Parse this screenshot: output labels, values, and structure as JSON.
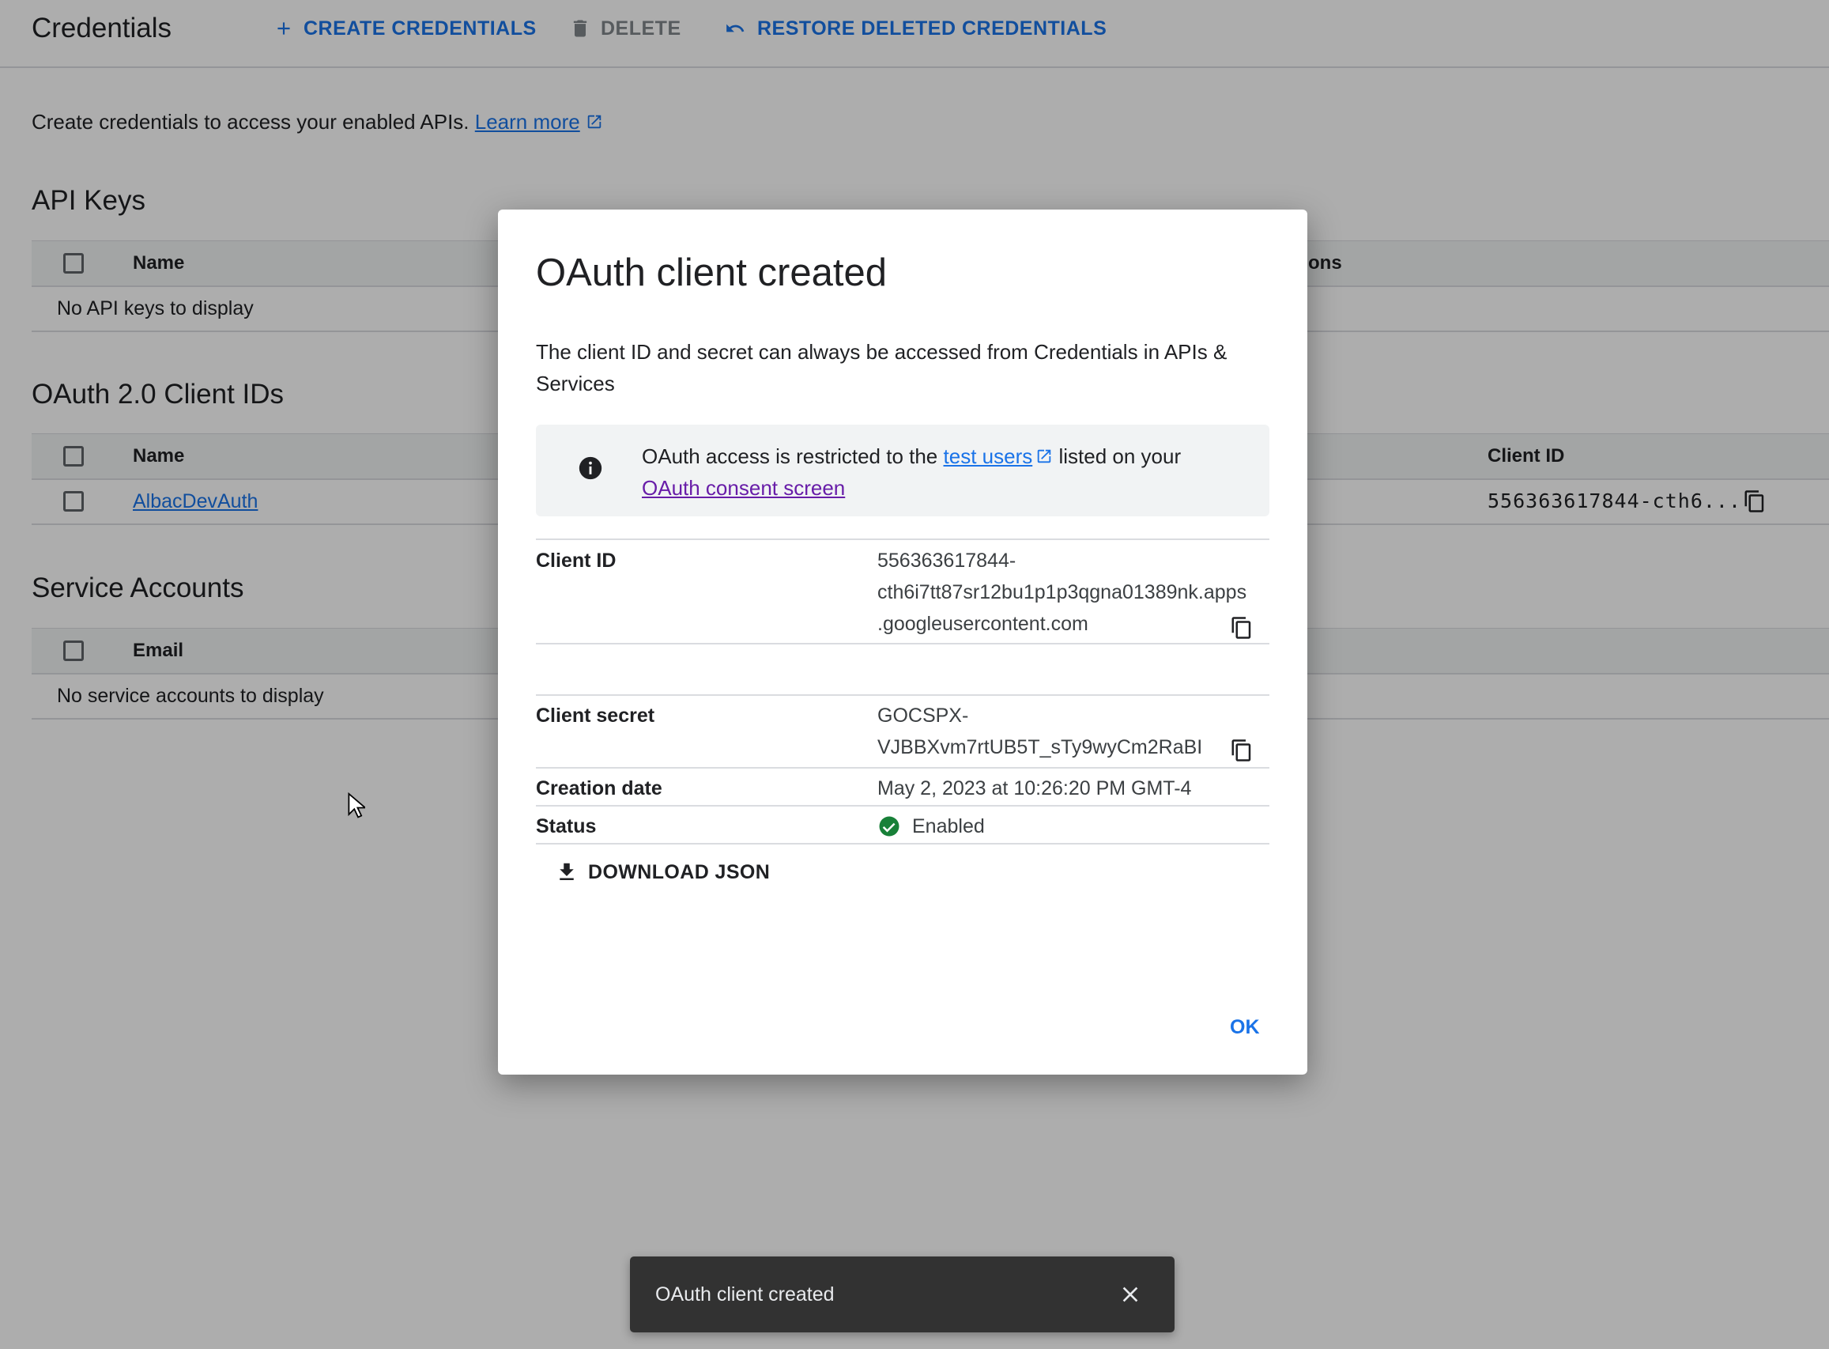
{
  "toolbar": {
    "title": "Credentials",
    "create_label": "CREATE CREDENTIALS",
    "delete_label": "DELETE",
    "restore_label": "RESTORE DELETED CREDENTIALS"
  },
  "intro": {
    "text": "Create credentials to access your enabled APIs.",
    "learn_more": "Learn more"
  },
  "api_keys": {
    "title": "API Keys",
    "col_name": "Name",
    "col_restrictions_partial": "ons",
    "empty": "No API keys to display"
  },
  "oauth_clients": {
    "title": "OAuth 2.0 Client IDs",
    "col_name": "Name",
    "col_client_id": "Client ID",
    "rows": [
      {
        "name": "AlbacDevAuth",
        "client_id": "556363617844-cth6..."
      }
    ]
  },
  "service_accounts": {
    "title": "Service Accounts",
    "col_email": "Email",
    "empty": "No service accounts to display"
  },
  "dialog": {
    "title": "OAuth client created",
    "description": "The client ID and secret can always be accessed from Credentials in APIs & Services",
    "notice": {
      "text_before": "OAuth access is restricted to the",
      "test_users_link": "test users",
      "text_after": "listed on your",
      "consent_link": "OAuth consent screen"
    },
    "client_id_label": "Client ID",
    "client_id_lines": [
      "556363617844-",
      "cth6i7tt87sr12bu1p1p3qgna01389nk.apps",
      ".googleusercontent.com"
    ],
    "client_secret_label": "Client secret",
    "client_secret_lines": [
      "GOCSPX-",
      "VJBBXvm7rtUB5T_sTy9wyCm2RaBI"
    ],
    "creation_date_label": "Creation date",
    "creation_date": "May 2, 2023 at 10:26:20 PM GMT-4",
    "status_label": "Status",
    "status": "Enabled",
    "download_label": "DOWNLOAD JSON",
    "ok_label": "OK"
  },
  "snackbar": {
    "text": "OAuth client created"
  },
  "colors": {
    "accent": "#1a73e8",
    "link_visited": "#681da8",
    "status_ok": "#188038",
    "snackbar_bg": "#323232"
  },
  "icons": [
    "plus-icon",
    "trash-icon",
    "undo-icon",
    "external-link-icon",
    "info-icon",
    "copy-icon",
    "check-circle-icon",
    "download-icon",
    "close-icon",
    "mouse-pointer-icon"
  ]
}
